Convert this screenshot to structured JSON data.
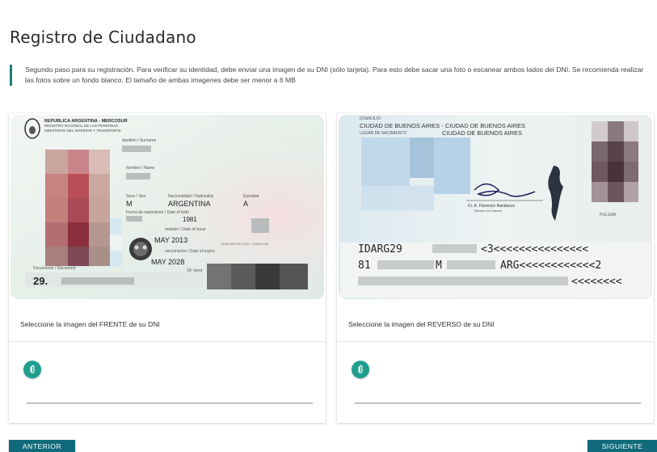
{
  "page": {
    "title": "Registro de Ciudadano",
    "instructions": "Segundo paso para su registración. Para verificar su identidad, debe enviar una imagen de su DNI (sólo tarjeta). Para esto debe sacar una foto o escanear ambos lados del DNI. Se recomienda realizar las fotos sobre un fondo blanco. El tamaño de ambas imagenes debe ser menor a 6 MB"
  },
  "front": {
    "caption": "Seleccione la imagen del FRENTE de su DNI",
    "id_text": {
      "header1": "REPUBLICA ARGENTINA - MERCOSUR",
      "header2": "REGISTRO NACIONAL DE LAS PERSONAS",
      "header3": "MINISTERIO DEL INTERIOR Y TRANSPORTE",
      "surname_label": "Apellido / Surname",
      "name_label": "Nombre / Name",
      "sex_label": "Sexo / Sex",
      "sex_value": "M",
      "nationality_label": "Nacionalidad / Nationality",
      "nationality_value": "ARGENTINA",
      "example_label": "Ejemplar",
      "example_value": "A",
      "birth_label": "Fecha de nacimiento / Date of birth",
      "birth_year": "1981",
      "issue_label": "emisión / Date of issue",
      "issue_value": "MAY 2013",
      "expiry_label": "vencimiento / Date of expiry",
      "expiry_value": "MAY 2028",
      "doc_label": "Documento / Document",
      "doc_value": "29.",
      "signature_label": "FIRMA IDENTIFICADO / SIGNATURE",
      "of_ident": "OF ident"
    }
  },
  "back": {
    "caption": "Seleccione la imagen del REVERSO de su DNI",
    "id_text": {
      "domicile_label": "DOMICILIO",
      "domicile_value": "CIUDAD DE BUENOS AIRES - CIUDAD DE BUENOS AIRES",
      "birthplace_label": "LUGAR DE NACIMIENTO",
      "birthplace_value": "CIUDAD DE BUENOS AIRES",
      "signer_name": "Cr. A. Florencio Randazzo",
      "signer_title": "Ministro del Interior",
      "thumb_label": "PULGAR",
      "mrz1_a": "IDARG29",
      "mrz1_b": "<3<<<<<<<<<<<<<<<",
      "mrz2_a": "81",
      "mrz2_b": "M",
      "mrz2_c": "ARG<<<<<<<<<<<<2",
      "mrz3": "<<<<<<<<"
    }
  },
  "nav": {
    "prev_label": "ANTERIOR",
    "next_label": "SIGUIENTE"
  },
  "colors": {
    "accent": "#1e7c7c",
    "attach": "#1f9e8e",
    "button": "#106a7a"
  }
}
